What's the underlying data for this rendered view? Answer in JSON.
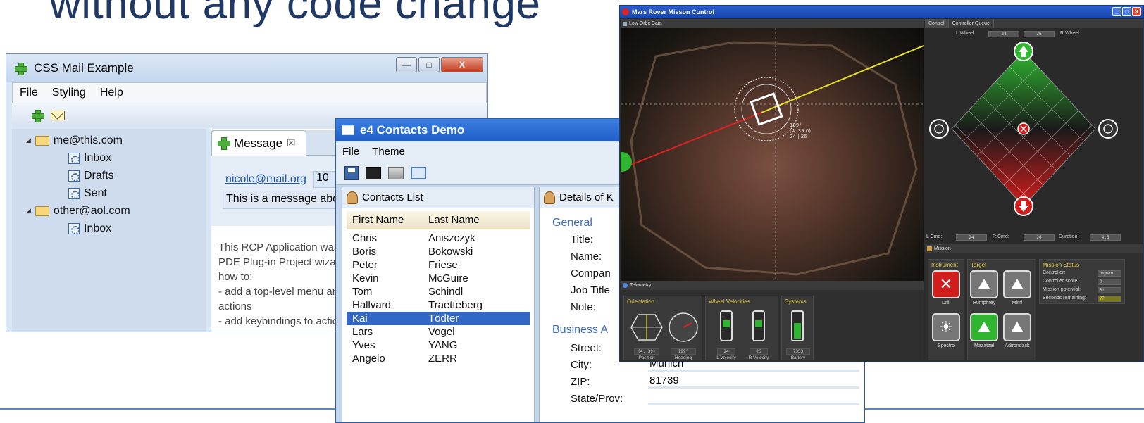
{
  "slide": {
    "title": "without any code change"
  },
  "mail": {
    "title": "CSS Mail Example",
    "window_buttons": {
      "minimize": "—",
      "maximize": "□",
      "close": "X"
    },
    "menu": [
      "File",
      "Styling",
      "Help"
    ],
    "tree": [
      {
        "label": "me@this.com",
        "level": 0,
        "type": "account"
      },
      {
        "label": "Inbox",
        "level": 1,
        "type": "folder"
      },
      {
        "label": "Drafts",
        "level": 1,
        "type": "folder"
      },
      {
        "label": "Sent",
        "level": 1,
        "type": "folder"
      },
      {
        "label": "other@aol.com",
        "level": 0,
        "type": "account"
      },
      {
        "label": "Inbox",
        "level": 1,
        "type": "folder"
      }
    ],
    "tab": {
      "label": "Message",
      "close": "☒"
    },
    "message": {
      "from": "nicole@mail.org",
      "date": "10",
      "subject": "This is a message about the cool Eclipse RCP!",
      "body": [
        "This RCP Application was generated from the",
        "PDE Plug-in Project wizard. This sample shows",
        "how to:",
        "- add a top-level menu and toolbar with",
        "actions",
        "- add keybindings to actions"
      ]
    }
  },
  "contacts": {
    "title": "e4 Contacts Demo",
    "menu": [
      "File",
      "Theme"
    ],
    "list_tab": "Contacts List",
    "columns": [
      "First Name",
      "Last Name"
    ],
    "rows": [
      [
        "Chris",
        "Aniszczyk"
      ],
      [
        "Boris",
        "Bokowski"
      ],
      [
        "Peter",
        "Friese"
      ],
      [
        "Kevin",
        "McGuire"
      ],
      [
        "Tom",
        "Schindl"
      ],
      [
        "Hallvard",
        "Traetteberg"
      ],
      [
        "Kai",
        "Tödter"
      ],
      [
        "Lars",
        "Vogel"
      ],
      [
        "Yves",
        "YANG"
      ],
      [
        "Angelo",
        "ZERR"
      ]
    ],
    "selected_row": 6,
    "details_tab": "Details of K",
    "sections": {
      "general": "General",
      "business": "Business A"
    },
    "fields": {
      "title": "Title:",
      "name": "Name:",
      "company": "Compan",
      "job": "Job Title",
      "note": "Note:",
      "street": "Street:",
      "city": "City:",
      "zip": "ZIP:",
      "state": "State/Prov:"
    },
    "values": {
      "city": "Munich",
      "zip": "81739",
      "street": "",
      "state": ""
    }
  },
  "rover": {
    "title": "Mars Rover Misson Control",
    "cam_tab": "Low Orbit Cam",
    "overlay": {
      "line1": "199°",
      "line2": "(4, 39.0)",
      "line3": "24 | 26"
    },
    "control_tabs": [
      "Control",
      "Controller Queue"
    ],
    "l_wheel_label": "L Wheel",
    "r_wheel_label": "R Wheel",
    "l_wheel": "24",
    "r_wheel": "26",
    "l_cmd_label": "L Cmd:",
    "l_cmd": "24",
    "r_cmd_label": "R Cmd:",
    "r_cmd": "26",
    "duration_label": "Duration:",
    "duration": "4.6",
    "telemetry_tab": "Telemetry",
    "orientation": {
      "title": "Orientation",
      "position": "(4, 39)",
      "position_label": "Position",
      "heading": "199°",
      "heading_label": "Heading"
    },
    "wheels": {
      "title": "Wheel Velocities",
      "l": "24",
      "l_label": "L Velocity",
      "r": "26",
      "r_label": "R Velocity"
    },
    "systems": {
      "title": "Systems",
      "battery": "7353",
      "battery_label": "Battery"
    },
    "mission_tab": "Mission",
    "instrument": {
      "title": "Instrument",
      "drill": "Drill",
      "spectro": "Spectro"
    },
    "target": {
      "title": "Target",
      "items": [
        "Humphrey",
        "Mimi",
        "Mazatzal",
        "Adirondack"
      ]
    },
    "status": {
      "title": "Mission Status",
      "rows": [
        {
          "label": "Controller:",
          "value": "rogram"
        },
        {
          "label": "Controller score:",
          "value": "0"
        },
        {
          "label": "Mission potential:",
          "value": "81"
        },
        {
          "label": "Seconds remaining:",
          "value": "77"
        }
      ]
    },
    "colors": {
      "accent": "#e2c84a",
      "go": "#2fb52f",
      "stop": "#d21d1d"
    }
  }
}
